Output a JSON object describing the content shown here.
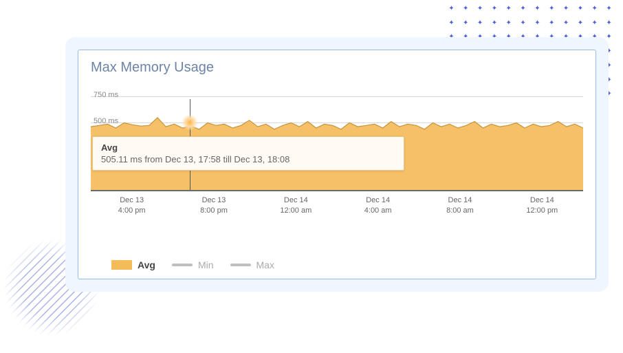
{
  "title": "Max Memory Usage",
  "tooltip": {
    "title": "Avg",
    "body": "505.11 ms from Dec 13, 17:58 till Dec 13, 18:08"
  },
  "y_ticks": [
    "750 ms",
    "500 ms"
  ],
  "x_ticks": [
    {
      "d": "Dec 13",
      "t": "4:00 pm"
    },
    {
      "d": "Dec 13",
      "t": "8:00 pm"
    },
    {
      "d": "Dec 14",
      "t": "12:00 am"
    },
    {
      "d": "Dec 14",
      "t": "4:00 am"
    },
    {
      "d": "Dec 14",
      "t": "8:00 am"
    },
    {
      "d": "Dec 14",
      "t": "12:00 pm"
    }
  ],
  "legend": {
    "avg": "Avg",
    "min": "Min",
    "max": "Max"
  },
  "colors": {
    "fill": "#f4bb5a",
    "stroke": "#c7943a",
    "min_line": "#bfbfbf",
    "max_line": "#bfbfbf",
    "card_border": "#97bce8",
    "card_bg": "#f0f6ff",
    "title": "#6d84a8"
  },
  "chart_data": {
    "type": "area",
    "title": "Max Memory Usage",
    "ylabel": "ms",
    "ylim": [
      0,
      800
    ],
    "xlim": [
      "Dec 13 14:00",
      "Dec 14 14:00"
    ],
    "grid": true,
    "legend_position": "bottom",
    "series": [
      {
        "name": "Avg",
        "color": "#f4bb5a",
        "values": [
          490,
          500,
          510,
          480,
          520,
          505,
          495,
          500,
          560,
          490,
          510,
          480,
          495,
          470,
          520,
          500,
          510,
          480,
          500,
          540,
          490,
          510,
          470,
          500,
          520,
          490,
          530,
          480,
          510,
          500,
          470,
          520,
          490,
          500,
          510,
          480,
          530,
          490,
          510,
          500,
          470,
          520,
          490,
          510,
          480,
          500,
          530,
          480,
          510,
          490,
          500,
          520,
          480,
          510,
          490,
          500,
          530,
          490,
          510,
          480
        ]
      },
      {
        "name": "Min",
        "color": "#bfbfbf",
        "values": []
      },
      {
        "name": "Max",
        "color": "#bfbfbf",
        "values": []
      }
    ],
    "cursor": {
      "x_label": "Dec 13, 17:58 – 18:08",
      "value": 505.11,
      "unit": "ms"
    }
  }
}
